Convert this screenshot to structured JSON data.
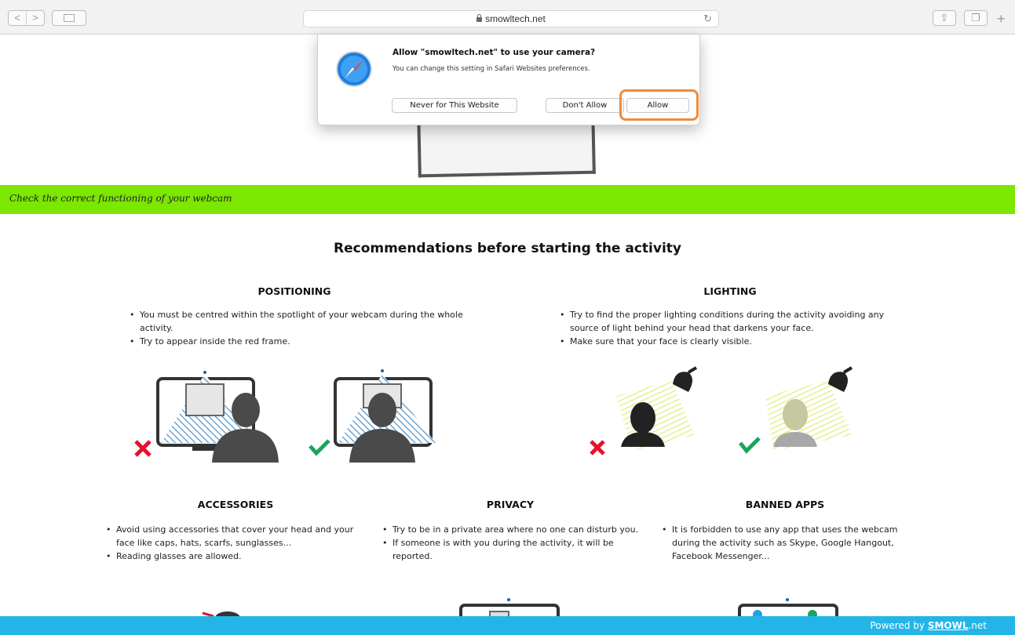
{
  "browser": {
    "url": "smowltech.net",
    "back_label": "<",
    "forward_label": ">",
    "new_tab_label": "+"
  },
  "dialog": {
    "title": "Allow \"smowltech.net\" to use your camera?",
    "text": "You can change this setting in Safari Websites preferences.",
    "never_label": "Never for This Website",
    "dont_allow_label": "Don't Allow",
    "allow_label": "Allow"
  },
  "banner": {
    "text": "Check the correct functioning of your webcam"
  },
  "main": {
    "title": "Recommendations before starting the activity",
    "positioning": {
      "title": "POSITIONING",
      "items": [
        "You must be centred within the spotlight of your webcam during the whole activity.",
        "Try to appear inside the red frame."
      ]
    },
    "lighting": {
      "title": "LIGHTING",
      "items": [
        "Try to find the proper lighting conditions during the activity avoiding any source of light behind your head that darkens your face.",
        "Make sure that your face is clearly visible."
      ]
    },
    "accessories": {
      "title": "ACCESSORIES",
      "items": [
        "Avoid using accessories that cover your head and your face like caps, hats, scarfs, sunglasses...",
        "Reading glasses are allowed."
      ]
    },
    "privacy": {
      "title": "PRIVACY",
      "items": [
        "Try to be in a private area where no one can disturb you.",
        "If someone is with you during the activity, it will be reported."
      ]
    },
    "banned_apps": {
      "title": "BANNED APPS",
      "items": [
        "It is forbidden to use any app that uses the webcam during the activity such as Skype, Google Hangout, Facebook Messenger..."
      ]
    }
  },
  "footer": {
    "prefix": "Powered by ",
    "brand_bold": "SMOWL",
    "brand_suffix": ".net"
  },
  "colors": {
    "banner": "#7ce700",
    "footer": "#23b5e8",
    "highlight": "#ee8c3c",
    "wrong": "#e8112d",
    "correct": "#1aa55a",
    "stripes_blue": "#4a90c8",
    "stripes_yellow": "#e6ef90"
  },
  "icons": [
    "safari-icon",
    "lock-icon",
    "reload-icon",
    "share-icon",
    "tabs-icon",
    "sidebar-icon",
    "cross-icon",
    "check-icon",
    "lamp-icon"
  ]
}
